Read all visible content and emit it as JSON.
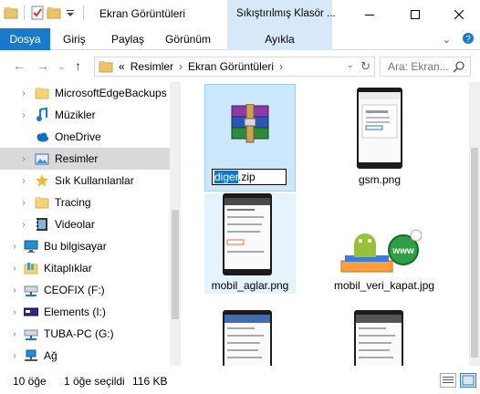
{
  "titlebar": {
    "title": "Ekran Görüntüleri",
    "context_tab": "Sıkıştırılmış Klasör ..."
  },
  "ribbon": {
    "tabs": [
      "Dosya",
      "Giriş",
      "Paylaş",
      "Görünüm",
      "Ayıkla"
    ],
    "expand_icon": "chevron-down-icon",
    "help_icon": "help-icon"
  },
  "address": {
    "overflow": "«",
    "crumbs": [
      "Resimler",
      "Ekran Görüntüleri"
    ],
    "search_placeholder": "Ara: Ekran..."
  },
  "navpane": {
    "items": [
      {
        "label": "MicrosoftEdgeBackups",
        "icon": "folder-icon"
      },
      {
        "label": "Müzikler",
        "icon": "music-icon"
      },
      {
        "label": "OneDrive",
        "icon": "cloud-icon"
      },
      {
        "label": "Resimler",
        "icon": "pictures-icon"
      },
      {
        "label": "Sık Kullanılanlar",
        "icon": "star-icon"
      },
      {
        "label": "Tracing",
        "icon": "folder-icon"
      },
      {
        "label": "Videolar",
        "icon": "video-icon"
      },
      {
        "label": "Bu bilgisayar",
        "icon": "computer-icon"
      },
      {
        "label": "Kitaplıklar",
        "icon": "libraries-icon"
      },
      {
        "label": "CEOFIX (F:)",
        "icon": "network-drive-icon"
      },
      {
        "label": "Elements (I:)",
        "icon": "drive-icon"
      },
      {
        "label": "TUBA-PC (G:)",
        "icon": "network-drive-icon"
      },
      {
        "label": "Ağ",
        "icon": "network-icon"
      }
    ]
  },
  "files": {
    "rename_selected": "diger",
    "rename_rest": ".zip",
    "items": [
      "gsm.png",
      "mobil_aglar.png",
      "mobil_veri_kapat.jpg"
    ]
  },
  "status": {
    "count": "10 öğe",
    "selection": "1 öğe seçildi",
    "size": "116 KB"
  },
  "colors": {
    "accent": "#1979ca",
    "selection": "#cce8ff",
    "context_tab": "#d7e9f9"
  }
}
